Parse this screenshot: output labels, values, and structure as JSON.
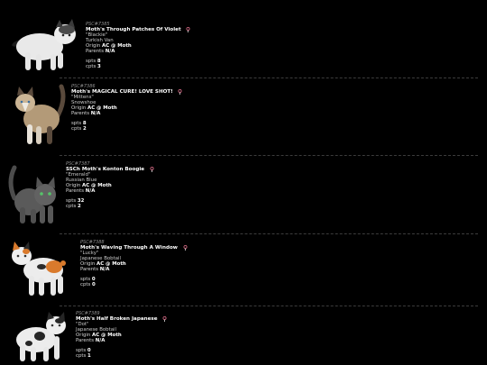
{
  "entries": [
    {
      "pid": "PSC#7385",
      "name": "Moth's Through Patches Of Violet",
      "nickname": "\"Blackie\"",
      "breed": "Turkish Van",
      "origin_label": "Origin",
      "origin": "AC @ Moth",
      "parents_label": "Parents",
      "parents": "N/A",
      "spts_label": "spts",
      "spts": "8",
      "cpts_label": "cpts",
      "cpts": "3",
      "flag_icon": "female-icon"
    },
    {
      "pid": "PSC#7386",
      "name": "Moth's MAGICAL CURE! LOVE SHOT!",
      "nickname": "\"Mittens\"",
      "breed": "Snowshoe",
      "origin_label": "Origin",
      "origin": "AC @ Moth",
      "parents_label": "Parents",
      "parents": "N/A",
      "spts_label": "spts",
      "spts": "8",
      "cpts_label": "cpts",
      "cpts": "2",
      "flag_icon": "female-icon"
    },
    {
      "pid": "PSC#7387",
      "name": "SSCh Moth's Konton Boogie",
      "nickname": "\"Emerald\"",
      "breed": "Russian Blue",
      "origin_label": "Origin",
      "origin": "AC @ Moth",
      "parents_label": "Parents",
      "parents": "N/A",
      "spts_label": "spts",
      "spts": "32",
      "cpts_label": "cpts",
      "cpts": "2",
      "flag_icon": "female-icon"
    },
    {
      "pid": "PSC#7388",
      "name": "Moth's Waving Through A Window",
      "nickname": "\"Lucky\"",
      "breed": "Japanese Bobtail",
      "origin_label": "Origin",
      "origin": "AC @ Moth",
      "parents_label": "Parents",
      "parents": "N/A",
      "spts_label": "spts",
      "spts": "0",
      "cpts_label": "cpts",
      "cpts": "0",
      "flag_icon": "female-icon"
    },
    {
      "pid": "PSC#7389",
      "name": "Moth's Half Broken Japanese",
      "nickname": "\"Dot\"",
      "breed": "Japanese Bobtail",
      "origin_label": "Origin",
      "origin": "AC @ Moth",
      "parents_label": "Parents",
      "parents": "N/A",
      "spts_label": "spts",
      "spts": "0",
      "cpts_label": "cpts",
      "cpts": "1",
      "flag_icon": "female-icon"
    }
  ],
  "colors": {
    "background": "#000000",
    "divider": "#3c3c3c",
    "name": "#ffffff",
    "flag_accent": "#e06f8b"
  }
}
